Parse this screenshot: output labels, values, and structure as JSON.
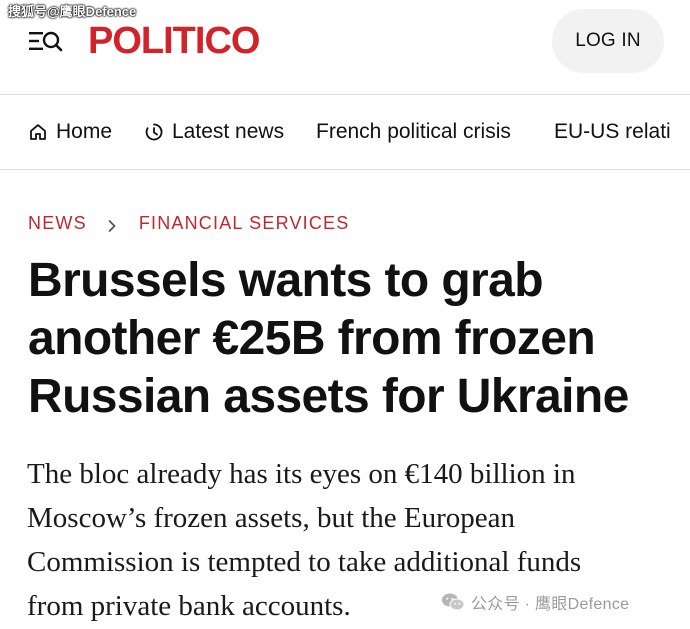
{
  "watermark": {
    "top_left": "搜狐号@鹰眼Defence",
    "bottom_right": "公众号 · 鹰眼Defence",
    "bottom_icon": "wechat-icon"
  },
  "header": {
    "menu_icon": "menu-search-icon",
    "logo_text": "POLITICO",
    "login_label": "LOG IN",
    "brand_color": "#d2232a"
  },
  "nav": {
    "items": [
      {
        "label": "Home",
        "icon": "home-icon"
      },
      {
        "label": "Latest news",
        "icon": "clock-icon"
      },
      {
        "label": "French political crisis"
      },
      {
        "label": "EU-US relati"
      }
    ]
  },
  "breadcrumb": {
    "section": "NEWS",
    "subsection": "FINANCIAL SERVICES",
    "separator_icon": "chevron-right-icon",
    "color": "#c2272d"
  },
  "article": {
    "headline_lines": [
      "Brussels wants to grab",
      "another €25B from frozen",
      "Russian assets for Ukraine"
    ],
    "dek_lines": [
      "The bloc already has its eyes on €140 billion in",
      "Moscow’s frozen assets, but the European",
      "Commission is tempted to take additional funds",
      "from private bank accounts."
    ]
  }
}
